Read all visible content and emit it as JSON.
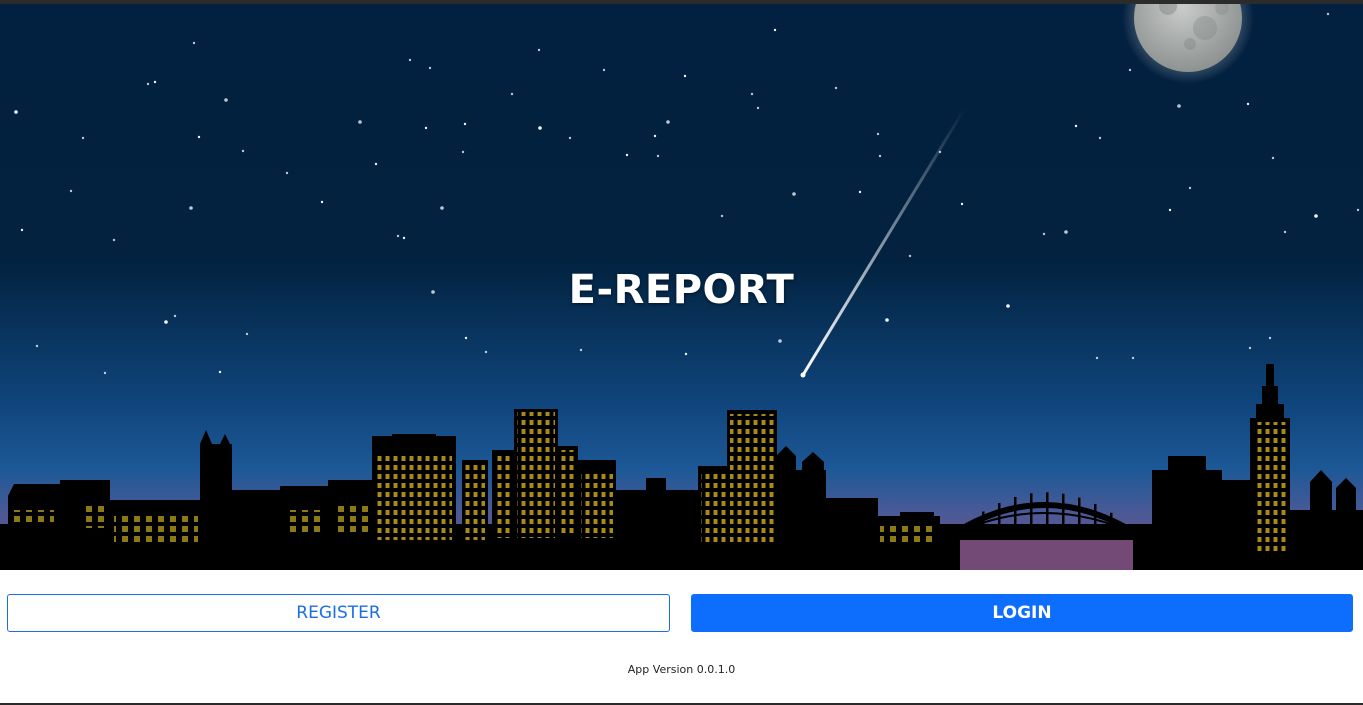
{
  "hero": {
    "title": "E-REPORT",
    "scene": [
      "night-sky",
      "full-moon",
      "shooting-star",
      "city-skyline",
      "arch-bridge"
    ]
  },
  "actions": {
    "register_label": "REGISTER",
    "login_label": "LOGIN"
  },
  "footer": {
    "version_text": "App Version 0.0.1.0"
  },
  "colors": {
    "sky_top": "#02203f",
    "sky_mid": "#0c3c6e",
    "sky_horizon": "#1f5c98",
    "dusk": "#7b4d80",
    "window_light": "#a78a17",
    "primary": "#0d6efd"
  }
}
